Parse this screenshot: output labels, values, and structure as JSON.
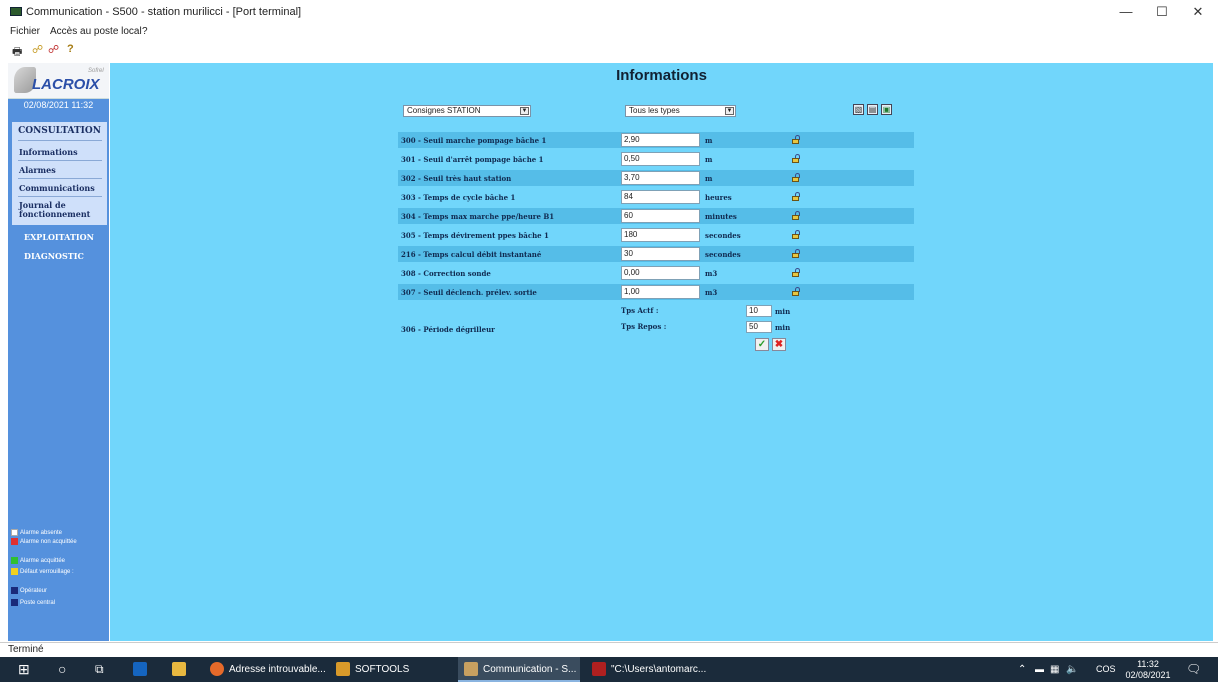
{
  "window": {
    "title": "Communication - S500 - station murilicci - [Port terminal]",
    "minimize": "—",
    "maximize": "☐",
    "close": "✕"
  },
  "menu": {
    "file": "Fichier",
    "local_access": "Accès au poste local",
    "help": "?"
  },
  "toolbar": {
    "print_icon": "🖶",
    "connect_icon": "☍",
    "disconnect_icon": "☍",
    "help_icon": "?"
  },
  "sidebar": {
    "brand": "LACROIX",
    "brand_sub": "Sofrel",
    "date": "02/08/2021 11:32",
    "consultation": "CONSULTATION",
    "items": [
      "Informations",
      "Alarmes",
      "Communications",
      "Journal de fonctionnement"
    ],
    "exploitation": "EXPLOITATION",
    "diagnostic": "DIAGNOSTIC",
    "legend": {
      "alarm_absent": "Alarme absente",
      "alarm_unack": "Alarme non acquittée",
      "alarm_ack": "Alarme acquittée",
      "lock_fault": "Défaut verrouillage :",
      "operator": "Opérateur",
      "central": "Poste central"
    }
  },
  "main": {
    "title": "Informations",
    "filter_category": "Consignes STATION",
    "filter_type": "Tous les types",
    "rows": [
      {
        "label": "300 - Seuil marche pompage bâche 1",
        "value": "2,90",
        "unit": "m"
      },
      {
        "label": "301 - Seuil d'arrêt pompage bâche 1",
        "value": "0,50",
        "unit": "m"
      },
      {
        "label": "302 - Seuil très haut station",
        "value": "3,70",
        "unit": "m"
      },
      {
        "label": "303 - Temps de cycle bâche 1",
        "value": "84",
        "unit": "heures"
      },
      {
        "label": "304 - Temps max marche ppe/heure B1",
        "value": "60",
        "unit": "minutes"
      },
      {
        "label": "305 - Temps dévirement ppes bâche 1",
        "value": "180",
        "unit": "secondes"
      },
      {
        "label": "216 - Temps calcul débit instantané",
        "value": "30",
        "unit": "secondes"
      },
      {
        "label": "308 - Correction sonde",
        "value": "0,00",
        "unit": "m3"
      },
      {
        "label": "307 - Seuil déclench. prélev. sortie",
        "value": "1,00",
        "unit": "m3"
      }
    ],
    "degrilleur": {
      "label": "306 - Période dégrilleur",
      "active_label": "Tps Actf :",
      "active_value": "10",
      "active_unit": "min",
      "rest_label": "Tps Repos :",
      "rest_value": "50",
      "rest_unit": "min"
    },
    "ok_symbol": "✓",
    "cancel_symbol": "✖"
  },
  "status": {
    "text": "Terminé"
  },
  "taskbar": {
    "items": [
      {
        "label": "Adresse introuvable..."
      },
      {
        "label": "SOFTOOLS"
      },
      {
        "label": "Communication - S..."
      },
      {
        "label": "\"C:\\Users\\antomarc..."
      }
    ],
    "lang": "COS",
    "time": "11:32",
    "date": "02/08/2021"
  },
  "colors": {
    "sidebar": "#5591dd",
    "main_bg": "#71d6fb",
    "row_shade": "#55bde8",
    "taskbar": "#1b2b3b"
  }
}
